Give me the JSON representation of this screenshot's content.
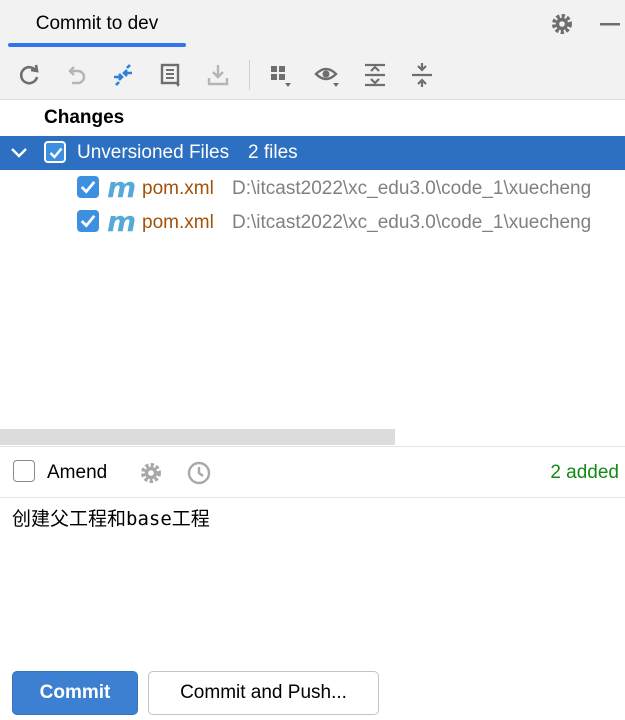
{
  "header": {
    "tab_label": "Commit to dev",
    "icons": [
      "gear-icon",
      "minimize-icon"
    ]
  },
  "toolbar": {
    "icons": [
      "refresh-icon",
      "rollback-icon",
      "diff-icon",
      "shelve-icon",
      "download-icon",
      "group-by-icon",
      "show-options-icon",
      "expand-all-icon",
      "collapse-all-icon"
    ]
  },
  "changes": {
    "title": "Changes",
    "group": {
      "label": "Unversioned Files",
      "count": "2 files",
      "checked": true
    },
    "files": [
      {
        "name": "pom.xml",
        "path": "D:\\itcast2022\\xc_edu3.0\\code_1\\xuecheng",
        "checked": true,
        "icon": "maven-icon"
      },
      {
        "name": "pom.xml",
        "path": "D:\\itcast2022\\xc_edu3.0\\code_1\\xuecheng",
        "checked": true,
        "icon": "maven-icon"
      }
    ]
  },
  "amend": {
    "label": "Amend",
    "checked": false,
    "status": "2 added"
  },
  "commit_message": "创建父工程和base工程",
  "buttons": {
    "commit": "Commit",
    "commit_and_push": "Commit and Push..."
  },
  "colors": {
    "accent": "#3574f0",
    "selection": "#2d6fc0",
    "file_name": "#a0520a",
    "added_status": "#138a13"
  }
}
